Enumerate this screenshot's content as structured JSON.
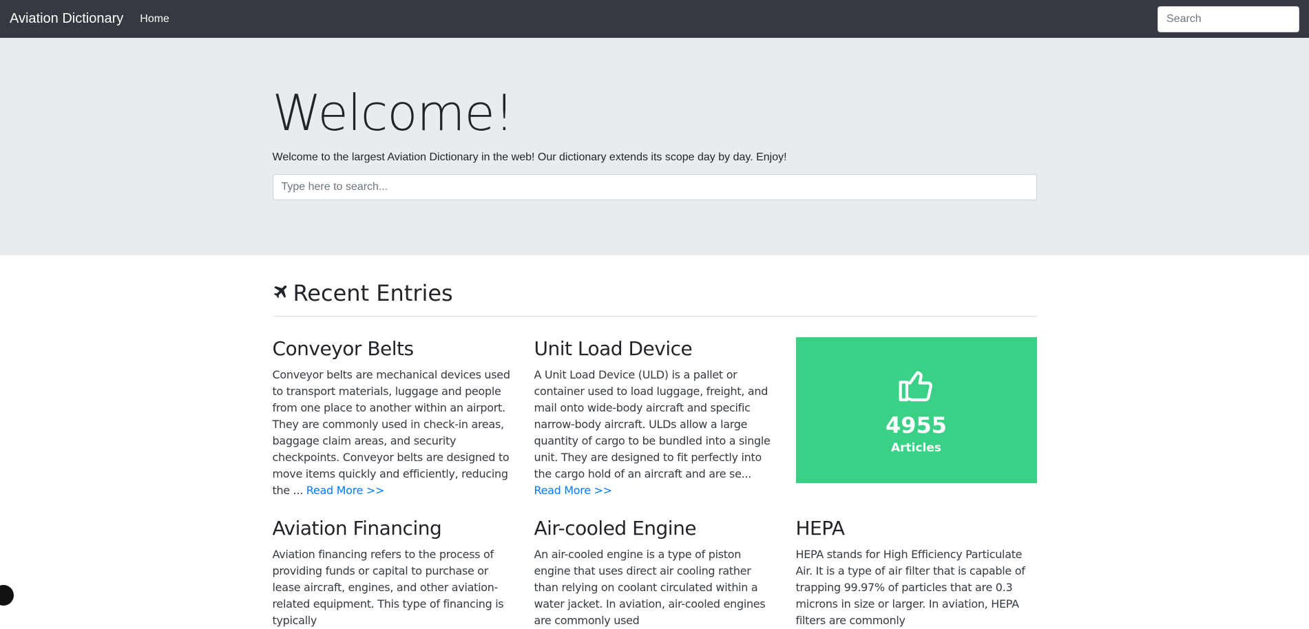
{
  "navbar": {
    "brand": "Aviation Dictionary",
    "home_label": "Home",
    "search_placeholder": "Search"
  },
  "hero": {
    "title": "Welcome!",
    "subtitle": "Welcome to the largest Aviation Dictionary in the web! Our dictionary extends its scope day by day. Enjoy!",
    "search_placeholder": "Type here to search..."
  },
  "recent": {
    "title": "Recent Entries",
    "icon": "plane-icon",
    "read_more_label": "Read More >>",
    "entries": [
      {
        "title": "Conveyor Belts",
        "excerpt": "Conveyor belts are mechanical devices used to transport materials, luggage and people from one place to another within an airport. They are commonly used in check-in areas, baggage claim areas, and security checkpoints. Conveyor belts are designed to move items quickly and efficiently, reducing the ... "
      },
      {
        "title": "Unit Load Device",
        "excerpt": "A Unit Load Device (ULD) is a pallet or container used to load luggage, freight, and mail onto wide-body aircraft and specific narrow-body aircraft. ULDs allow a large quantity of cargo to be bundled into a single unit. They are designed to fit perfectly into the cargo hold of an aircraft and are se... "
      },
      {
        "title": "Aviation Financing",
        "excerpt": "Aviation financing refers to the process of providing funds or capital to purchase or lease aircraft, engines, and other aviation-related equipment. This type of financing is typically"
      },
      {
        "title": "Air-cooled Engine",
        "excerpt": "An air-cooled engine is a type of piston engine that uses direct air cooling rather than relying on coolant circulated within a water jacket. In aviation, air-cooled engines are commonly used"
      },
      {
        "title": "HEPA",
        "excerpt": "HEPA stands for High Efficiency Particulate Air. It is a type of air filter that is capable of trapping 99.97% of particles that are 0.3 microns in size or larger. In aviation, HEPA filters are commonly"
      }
    ]
  },
  "stats": {
    "icon": "thumbs-up-icon",
    "count": "4955",
    "label": "Articles",
    "color": "#3ad086"
  },
  "colors": {
    "navbar": "#343a40",
    "jumbotron": "#e9ecef",
    "link": "#007bff"
  }
}
